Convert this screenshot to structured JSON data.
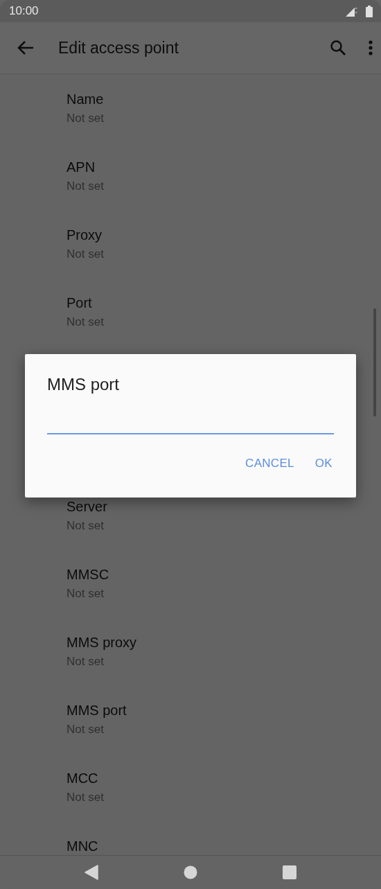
{
  "status_bar": {
    "time": "10:00"
  },
  "app_bar": {
    "title": "Edit access point"
  },
  "settings": [
    {
      "title": "Name",
      "value": "Not set"
    },
    {
      "title": "APN",
      "value": "Not set"
    },
    {
      "title": "Proxy",
      "value": "Not set"
    },
    {
      "title": "Port",
      "value": "Not set"
    },
    {
      "title": "Server",
      "value": "Not set"
    },
    {
      "title": "MMSC",
      "value": "Not set"
    },
    {
      "title": "MMS proxy",
      "value": "Not set"
    },
    {
      "title": "MMS port",
      "value": "Not set"
    },
    {
      "title": "MCC",
      "value": "Not set"
    },
    {
      "title": "MNC"
    }
  ],
  "dialog": {
    "title": "MMS port",
    "field": {
      "focused": true
    },
    "buttons": [
      "CANCEL",
      "OK"
    ]
  }
}
